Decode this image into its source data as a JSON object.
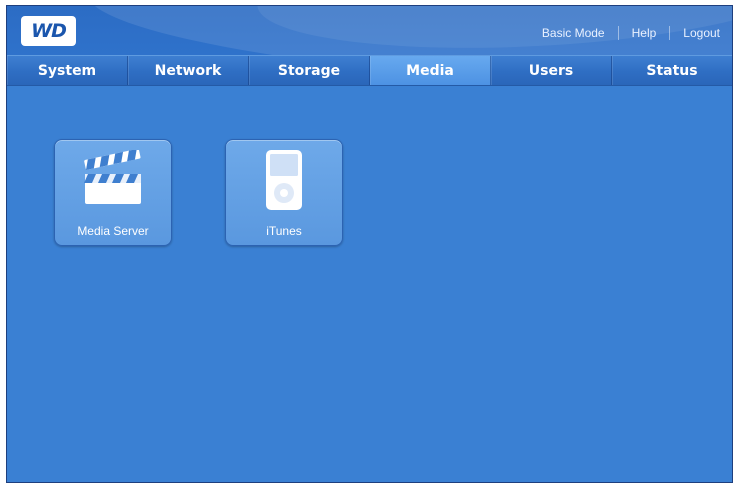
{
  "brand": {
    "logo_text": "WD"
  },
  "header": {
    "links": [
      {
        "label": "Basic Mode"
      },
      {
        "label": "Help"
      },
      {
        "label": "Logout"
      }
    ]
  },
  "nav": {
    "tabs": [
      {
        "label": "System"
      },
      {
        "label": "Network"
      },
      {
        "label": "Storage"
      },
      {
        "label": "Media",
        "active": true
      },
      {
        "label": "Users"
      },
      {
        "label": "Status"
      }
    ]
  },
  "main": {
    "tiles": [
      {
        "label": "Media Server",
        "icon": "clapperboard-icon"
      },
      {
        "label": "iTunes",
        "icon": "ipod-icon"
      }
    ]
  },
  "colors": {
    "background": "#3a80d3",
    "active_tab": "#5a9be6",
    "tile": "#6ea9e9"
  }
}
